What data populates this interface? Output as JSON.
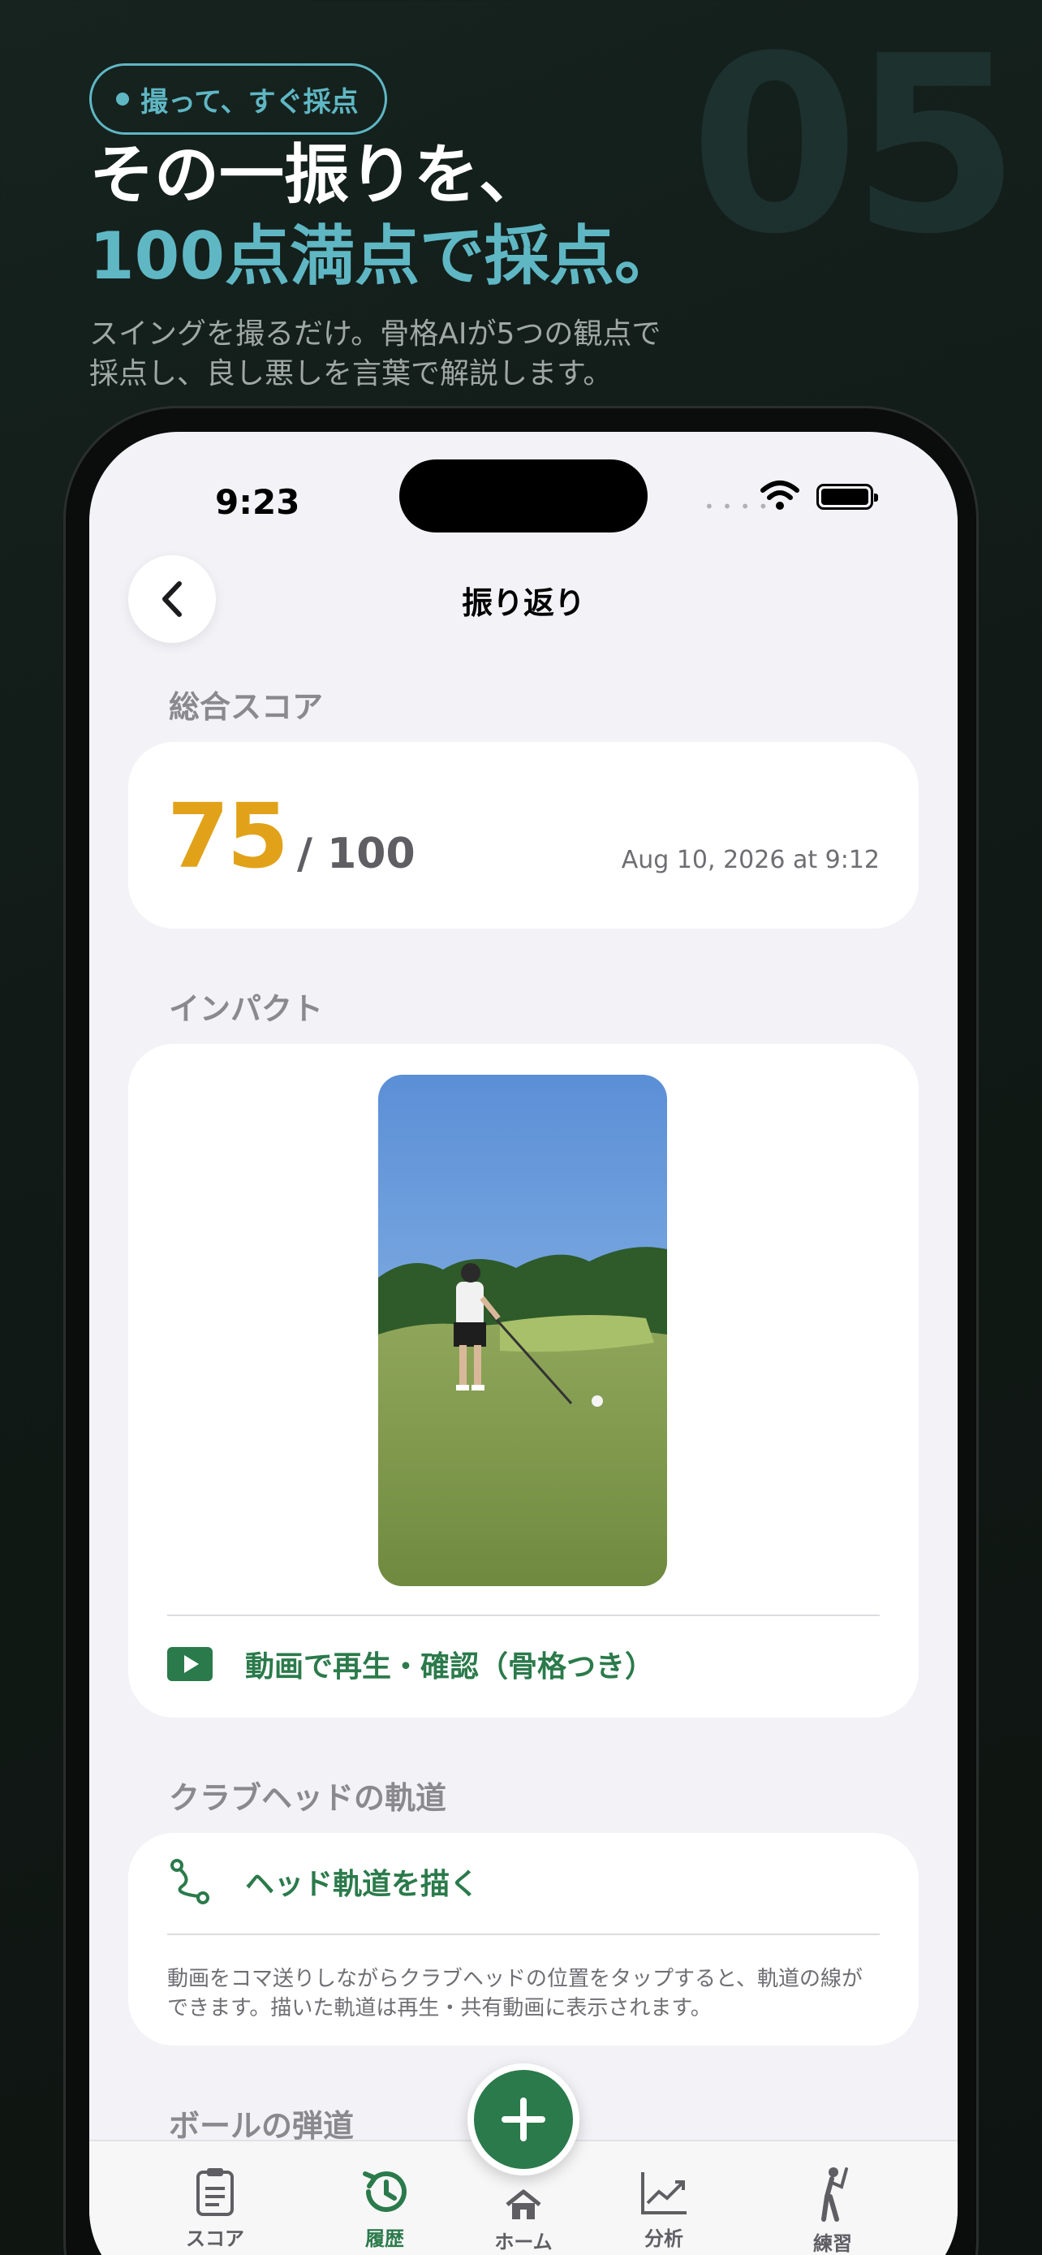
{
  "hero": {
    "number": "05",
    "pill_text": "撮って、すぐ採点",
    "headline_line1": "その一振りを、",
    "headline_line2": "100点満点で採点。",
    "subtitle_line1": "スイングを撮るだけ。骨格AIが5つの観点で",
    "subtitle_line2": "採点し、良し悪しを言葉で解説します。",
    "accent_color": "#5fb7c4"
  },
  "status_bar": {
    "time": "9:23"
  },
  "nav": {
    "title": "振り返り"
  },
  "score_section": {
    "label": "総合スコア",
    "score": "75",
    "denominator": "/ 100",
    "date": "Aug 10, 2026 at 9:12",
    "score_color": "#e1a21a"
  },
  "impact_section": {
    "label": "インパクト",
    "play_link": "動画で再生・確認（骨格つき）"
  },
  "club_section": {
    "label": "クラブヘッドの軌道",
    "action": "ヘッド軌道を描く",
    "description": "動画をコマ送りしながらクラブヘッドの位置をタップすると、軌道の線ができます。描いた軌道は再生・共有動画に表示されます。"
  },
  "ball_section": {
    "label": "ボールの弾道"
  },
  "tabbar": {
    "tabs": [
      {
        "label": "スコア",
        "icon": "clipboard-icon"
      },
      {
        "label": "履歴",
        "icon": "history-icon",
        "active": true
      },
      {
        "label": "ホーム",
        "icon": "home-icon"
      },
      {
        "label": "分析",
        "icon": "chart-icon"
      },
      {
        "label": "練習",
        "icon": "golfer-icon"
      }
    ],
    "active_color": "#2b7a4b"
  }
}
